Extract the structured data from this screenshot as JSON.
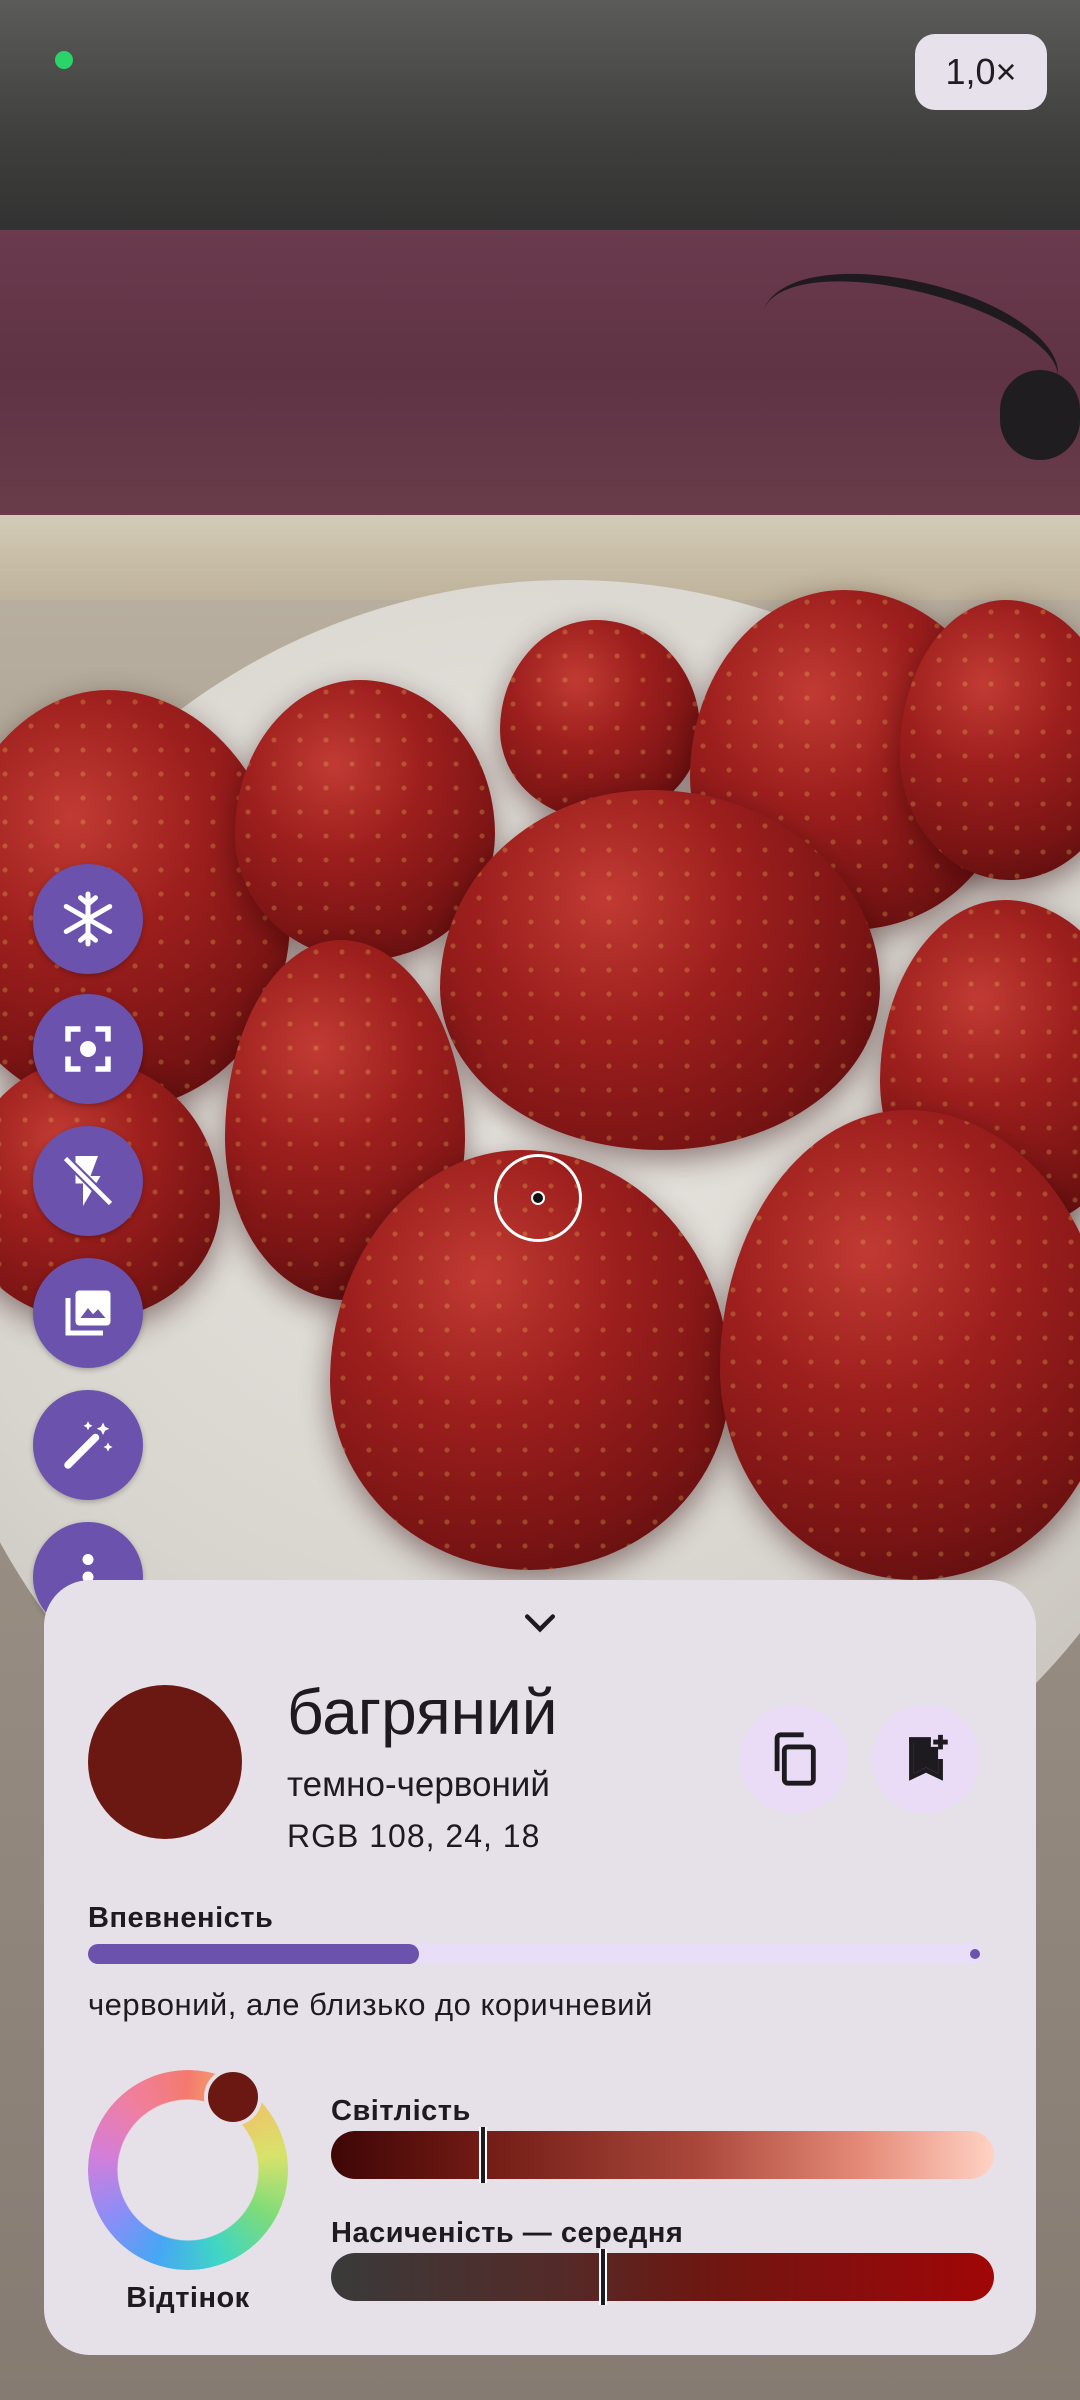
{
  "status": {
    "indicator_color": "#2bd46b"
  },
  "zoom": {
    "label": "1,0×"
  },
  "side_actions": [
    {
      "name": "freeze-button",
      "icon": "snowflake-icon"
    },
    {
      "name": "focus-button",
      "icon": "center-focus-icon"
    },
    {
      "name": "flash-button",
      "icon": "flash-off-icon"
    },
    {
      "name": "gallery-button",
      "icon": "photo-library-icon"
    },
    {
      "name": "magic-button",
      "icon": "magic-wand-icon"
    },
    {
      "name": "more-button",
      "icon": "more-vertical-icon"
    }
  ],
  "result": {
    "color_name": "багряний",
    "subtitle": "темно-червоний",
    "rgb_text": "RGB 108, 24, 18",
    "swatch_color": "#6c1812",
    "copy_icon": "copy-icon",
    "bookmark_icon": "bookmark-add-icon"
  },
  "confidence": {
    "label": "Впевненість",
    "value": 0.37,
    "description": "червоний, але близько до коричневий"
  },
  "hue": {
    "label": "Відтінок"
  },
  "lightness": {
    "label": "Світлість",
    "value": 0.23
  },
  "saturation": {
    "label": "Насиченість — середня",
    "value": 0.41
  },
  "colors": {
    "accent": "#6a52ad",
    "sheet": "#e6e0e9",
    "tonal": "#eadcf6"
  }
}
